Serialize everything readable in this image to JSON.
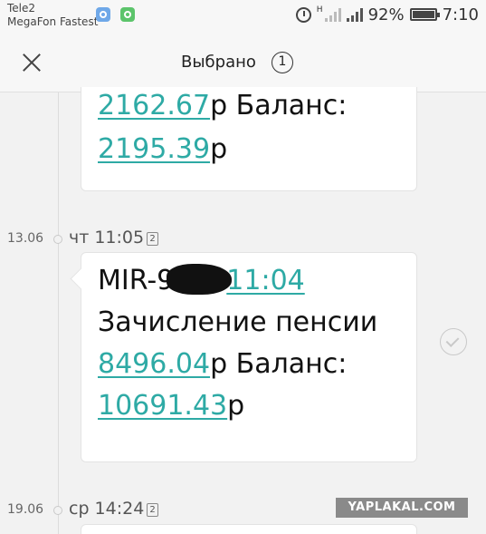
{
  "status_bar": {
    "carrier1": "Tele2",
    "carrier2": "MegaFon Fastest",
    "network_type": "H",
    "battery": "92%",
    "time": "7:10",
    "icons": [
      "vpn-icon",
      "app-icon",
      "alarm-icon",
      "signal-icon",
      "battery-icon"
    ]
  },
  "header": {
    "close_icon": "close-icon",
    "title": "Выбрано",
    "selected_count": "1"
  },
  "messages": [
    {
      "line1_amount": "2162.67",
      "line1_suffix": "р Баланс:",
      "line2_amount": "2195.39",
      "line2_suffix": "р"
    },
    {
      "date": "13.06",
      "time": "чт 11:05",
      "sim": "2",
      "sender_prefix": "MIR-9",
      "sender_time": "11:04",
      "text": "Зачисление пенсии",
      "amount": "8496.04",
      "amount_suffix": "р Баланс:",
      "balance": "10691.43",
      "balance_suffix": "р",
      "selected": true
    },
    {
      "date": "19.06",
      "time": "ср 14:24",
      "sim": "2"
    }
  ],
  "watermark": "YAPLAKAL.COM",
  "colors": {
    "link": "#2eaaa5",
    "background": "#f2f2f2"
  }
}
